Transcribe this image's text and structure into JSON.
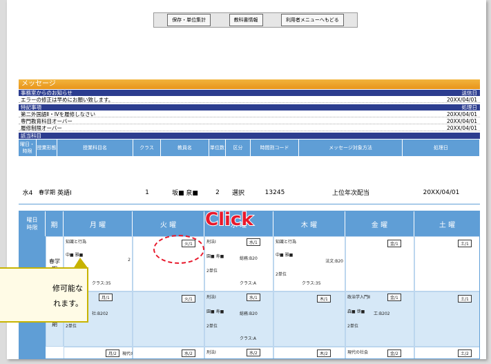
{
  "toolbar": {
    "btn1": "保存・単位集計",
    "btn2": "教科書情報",
    "btn3": "利用者メニューへもどる"
  },
  "message": {
    "title": "メッセージ",
    "office_head": "事務室からのお知らせ",
    "sent_date": "送信日",
    "office_msg": "エラーの修正は早めにお願い致します。",
    "office_date": "20XX/04/01",
    "special_head": "特記事項",
    "proc_date": "処理日",
    "items": [
      {
        "text": "第二外国語Ⅱ・Ⅳを履修しなさい",
        "date": "20XX/04/01"
      },
      {
        "text": "専門教育科目オーバー",
        "date": "20XX/04/01"
      },
      {
        "text": "履修制限オーバー",
        "date": "20XX/04/01"
      }
    ],
    "subject_head": "該当科目"
  },
  "subj_cols": [
    "曜日・時限",
    "授業形態",
    "授業科目名",
    "クラス",
    "教員名",
    "単位数",
    "区分",
    "時間割コード",
    "メッセージ対象方法",
    "処理日"
  ],
  "subj_row": [
    "水4",
    "春学期",
    "英語Ⅰ",
    "1",
    "坂■ 泉■",
    "2",
    "選択",
    "13245",
    "上位年次配当",
    "20XX/04/01"
  ],
  "grid": {
    "days": [
      "月 曜",
      "火 曜",
      "水 曜",
      "木 曜",
      "金 曜",
      "土 曜"
    ],
    "corner1": "曜日",
    "corner2": "時限",
    "col2": "期"
  },
  "cells": {
    "mon1": "知識と行為",
    "mon1b": "中■ 雅■",
    "mon1c": "2",
    "mon1d": "2単位",
    "mon1e": "クラス:35",
    "tue1": "火/1",
    "wed1": "刑法Ⅰ",
    "wed1b": "水/1",
    "wed1c": "園■ 寿■",
    "wed1d": "総務:B20",
    "wed1e": "2単位",
    "wed1f": "クラス:A",
    "thu1": "知識と行為",
    "thu1b": "中■ 雅■",
    "thu1c": "法文:B20",
    "thu1d": "2単位",
    "thu1e": "クラス:35",
    "fri1": "金/1",
    "sat1": "土/1",
    "mon2": "法思想史Ⅱ",
    "mon2b": "月/1",
    "mon2c": "市■ 達■",
    "mon2d": "社:B202",
    "mon2e": "2単位",
    "tue2": "火/1",
    "wed2": "刑法Ⅰ",
    "wed2b": "水/1",
    "wed2c": "園■ 寿■",
    "wed2d": "総務:B20",
    "wed2e": "2単位",
    "wed2f": "クラス:A",
    "thu2": "木/1",
    "fri2": "政治学入門Ⅱ",
    "fri2b": "金/1",
    "fri2c": "森■ 啓■",
    "fri2d": "工:B202",
    "fri2e": "2単位",
    "sat2": "土/1",
    "mon3": "月/2",
    "mon3b": "現代の社会",
    "tue3": "水/2",
    "wed3": "刑法Ⅰ",
    "wed3b": "水/2",
    "thu3": "木/2",
    "fri3": "現代の社会",
    "fri3b": "金/2",
    "sat3": "土/2",
    "term1": "春学期",
    "term2": "春学期"
  },
  "click": "Click",
  "callout": {
    "line1": "修可能な",
    "line2": "れます。"
  }
}
